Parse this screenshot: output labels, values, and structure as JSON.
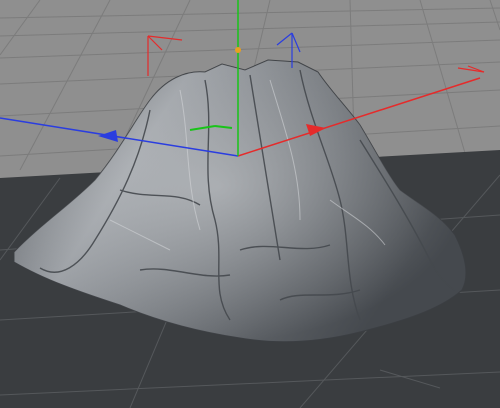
{
  "viewport": {
    "background_color": "#8f8f8f",
    "floor_color": "#3a3d40",
    "grid_line_color": "#7a7a7a",
    "floor_grid_color": "#55585b"
  },
  "scene": {
    "object": "terrain-mesh",
    "mesh_color": "#6f7378",
    "highlight_color": "#b8bcc0",
    "shadow_color": "#3b3e42"
  },
  "axes": {
    "x_color": "#e52b2b",
    "y_color": "#18c418",
    "z_color": "#2a3de0",
    "origin_handle_color": "#e8a020",
    "icons": [
      "x-axis-arrow-icon",
      "y-axis-arrow-icon",
      "z-axis-arrow-icon",
      "object-axis-icon"
    ]
  }
}
